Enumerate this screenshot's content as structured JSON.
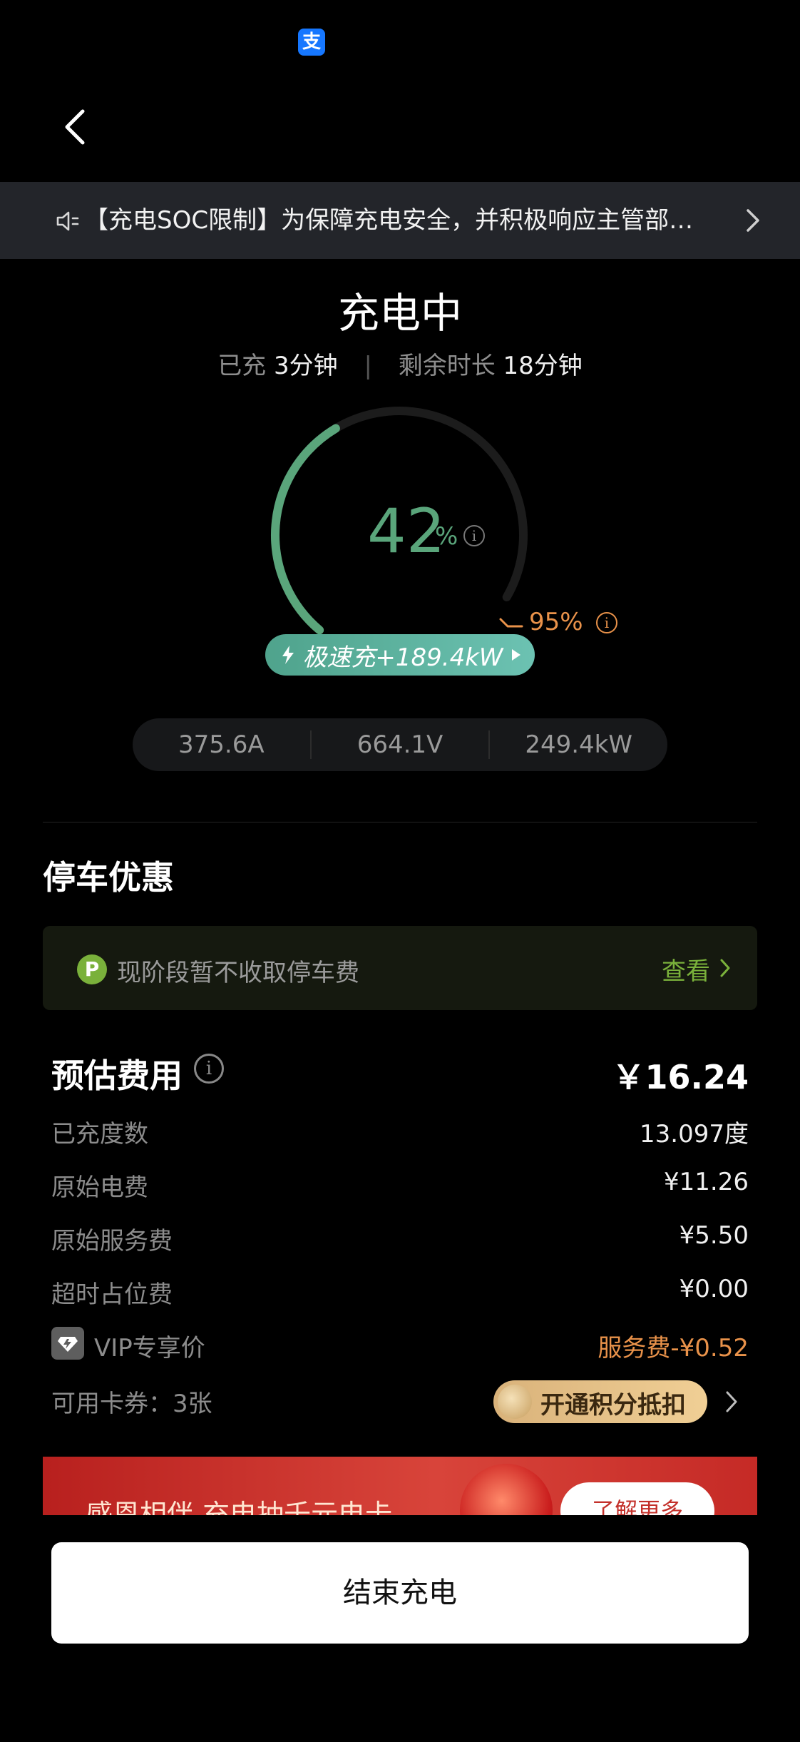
{
  "statusbar": {
    "app_icon": "alipay-icon",
    "app_icon_glyph": "支"
  },
  "nav": {
    "back_icon": "chevron-left-icon"
  },
  "notice": {
    "icon": "speaker-icon",
    "text": "【充电SOC限制】为保障充电安全，并积极响应主管部门要求，充电SOC上限调整"
  },
  "charging": {
    "status_title": "充电中",
    "charged_label": "已充",
    "charged_value": "3分钟",
    "remaining_label": "剩余时长",
    "remaining_value": "18分钟",
    "soc_percent": 42,
    "soc_display": "42",
    "soc_unit": "%",
    "target_percent": 95,
    "target_display": "95%",
    "mode_label": "极速充+189.4kW",
    "colors": {
      "progress": "#5aa57b",
      "target": "#e9924a"
    }
  },
  "metrics": {
    "current": "375.6A",
    "voltage": "664.1V",
    "power": "249.4kW"
  },
  "parking": {
    "section_title": "停车优惠",
    "badge": "P",
    "text": "现阶段暂不收取停车费",
    "link_label": "查看"
  },
  "fee": {
    "title": "预估费用",
    "total": "￥16.24",
    "rows": [
      {
        "label": "已充度数",
        "value": "13.097度"
      },
      {
        "label": "原始电费",
        "value": "¥11.26"
      },
      {
        "label": "原始服务费",
        "value": "¥5.50"
      },
      {
        "label": "超时占位费",
        "value": "¥0.00"
      }
    ],
    "vip_label": "VIP专享价",
    "vip_value": "服务费-¥0.52",
    "coupon_label": "可用卡券：3张",
    "points_button": "开通积分抵扣"
  },
  "banner": {
    "text": "感恩相伴 充电抽千元电卡",
    "button": "了解更多"
  },
  "footer": {
    "end_button": "结束充电"
  }
}
